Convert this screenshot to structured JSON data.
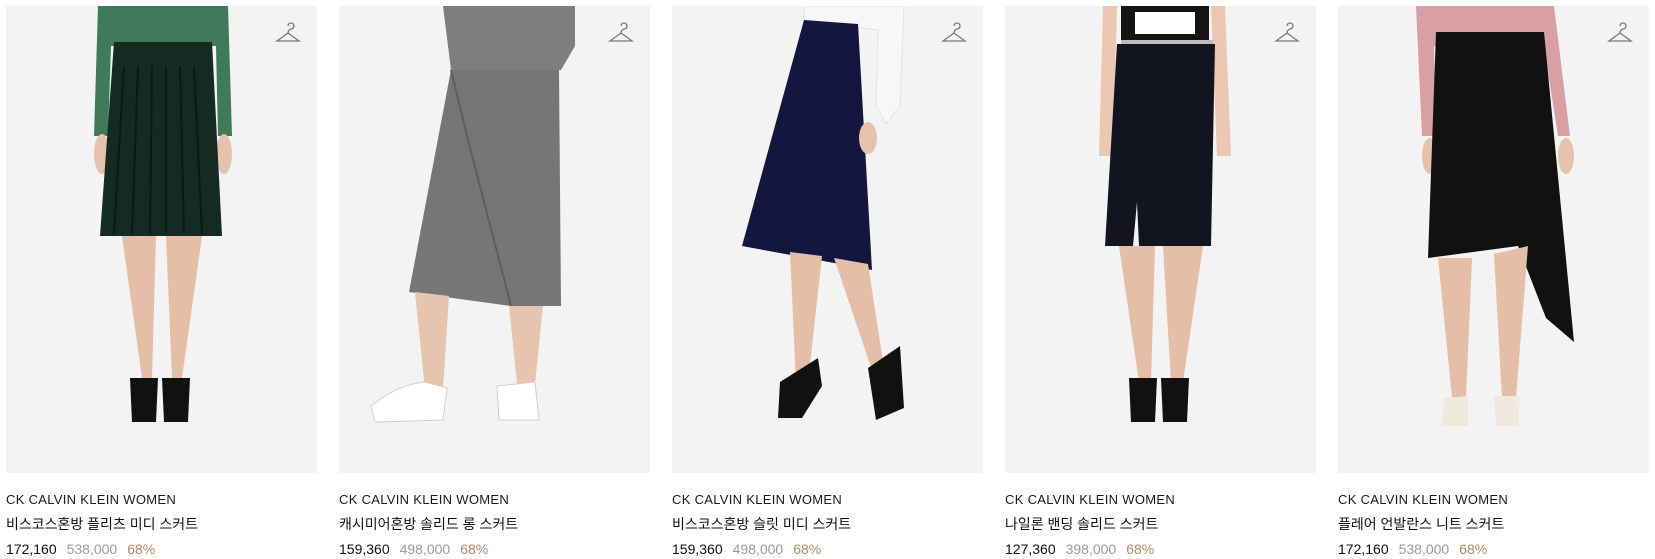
{
  "products": [
    {
      "brand": "CK CALVIN KLEIN WOMEN",
      "name": "비스코스혼방 플리츠 미디 스커트",
      "price": "172,160",
      "original_price": "538,000",
      "discount": "68%",
      "icon": "hanger-icon"
    },
    {
      "brand": "CK CALVIN KLEIN WOMEN",
      "name": "캐시미어혼방 솔리드 롱 스커트",
      "price": "159,360",
      "original_price": "498,000",
      "discount": "68%",
      "icon": "hanger-icon"
    },
    {
      "brand": "CK CALVIN KLEIN WOMEN",
      "name": "비스코스혼방 슬릿 미디 스커트",
      "price": "159,360",
      "original_price": "498,000",
      "discount": "68%",
      "icon": "hanger-icon"
    },
    {
      "brand": "CK CALVIN KLEIN WOMEN",
      "name": "나일론 밴딩 솔리드 스커트",
      "price": "127,360",
      "original_price": "398,000",
      "discount": "68%",
      "icon": "hanger-icon"
    },
    {
      "brand": "CK CALVIN KLEIN WOMEN",
      "name": "플레어 언발란스 니트 스커트",
      "price": "172,160",
      "original_price": "538,000",
      "discount": "68%",
      "icon": "hanger-icon"
    }
  ],
  "colors": {
    "discount": "#b38862",
    "original_price": "#9b9b9b",
    "image_bg": "#f3f3f3"
  }
}
